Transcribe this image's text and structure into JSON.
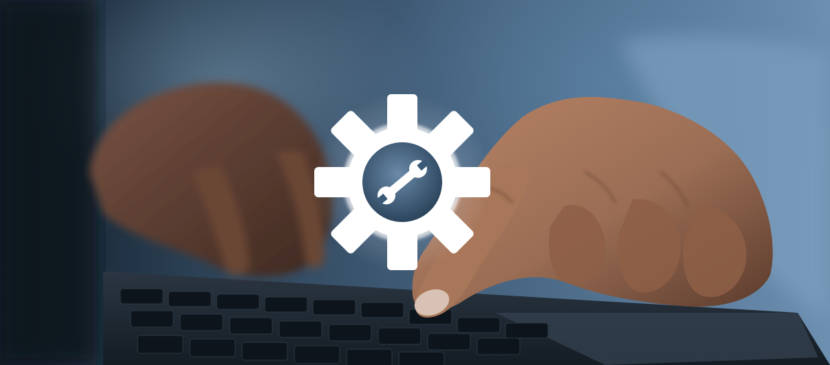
{
  "scene": {
    "description_subjects": [
      "hands",
      "laptop-keyboard",
      "gear-wrench-icon"
    ],
    "colors": {
      "background_dark": "#0f1c29",
      "background_blue": "#4f6f8d",
      "sleeve_blue": "#7d9fbf",
      "skin": "#9a6d54",
      "skin_shadow": "#5a3a2c",
      "keyboard": "#1c2530",
      "key": "#0e141b",
      "icon_glow": "#ffffff",
      "icon_center": "#3b5a78"
    },
    "icon": "gear-wrench-icon"
  }
}
